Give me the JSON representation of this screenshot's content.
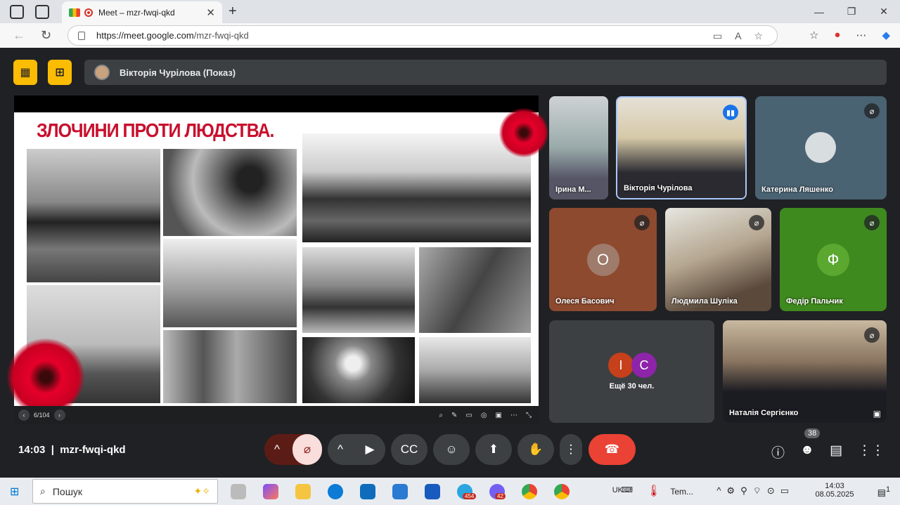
{
  "browser": {
    "tab_title": "Meet – mzr-fwqi-qkd",
    "new_tab": "+",
    "url_domain": "https://meet.google.com",
    "url_path": "/mzr-fwqi-qkd"
  },
  "presenter": {
    "label": "Вікторія Чурілова (Показ)"
  },
  "slide": {
    "title": "ЗЛОЧИНИ ПРОТИ ЛЮДСТВА.",
    "page_indicator": "6/104"
  },
  "participants": [
    {
      "name": "Ірина М...",
      "muted": false
    },
    {
      "name": "Вікторія Чурілова",
      "speaking": true
    },
    {
      "name": "Катерина Ляшенко",
      "muted": true
    },
    {
      "name": "Олеся Басович",
      "muted": true,
      "letter": "О",
      "color": "#8d4a2f"
    },
    {
      "name": "Людмила Шуліка",
      "muted": true
    },
    {
      "name": "Федір Пальчик",
      "muted": true,
      "letter": "Ф",
      "color": "#3f8a1f"
    },
    {
      "name": "Наталія Сергієнко",
      "muted": true
    }
  ],
  "others": {
    "label": "Ещё 30 чел.",
    "avatars": [
      {
        "letter": "І",
        "color": "#c5401b"
      },
      {
        "letter": "С",
        "color": "#8e24aa"
      }
    ]
  },
  "meeting": {
    "time": "14:03",
    "code": "mzr-fwqi-qkd",
    "participant_count": "38"
  },
  "taskbar": {
    "search_placeholder": "Пошук",
    "telegram_badge": "454",
    "viber_badge": "42",
    "lang": "UK",
    "weather": "Tem...",
    "time": "14:03",
    "date": "08.05.2025",
    "notif": "1"
  }
}
